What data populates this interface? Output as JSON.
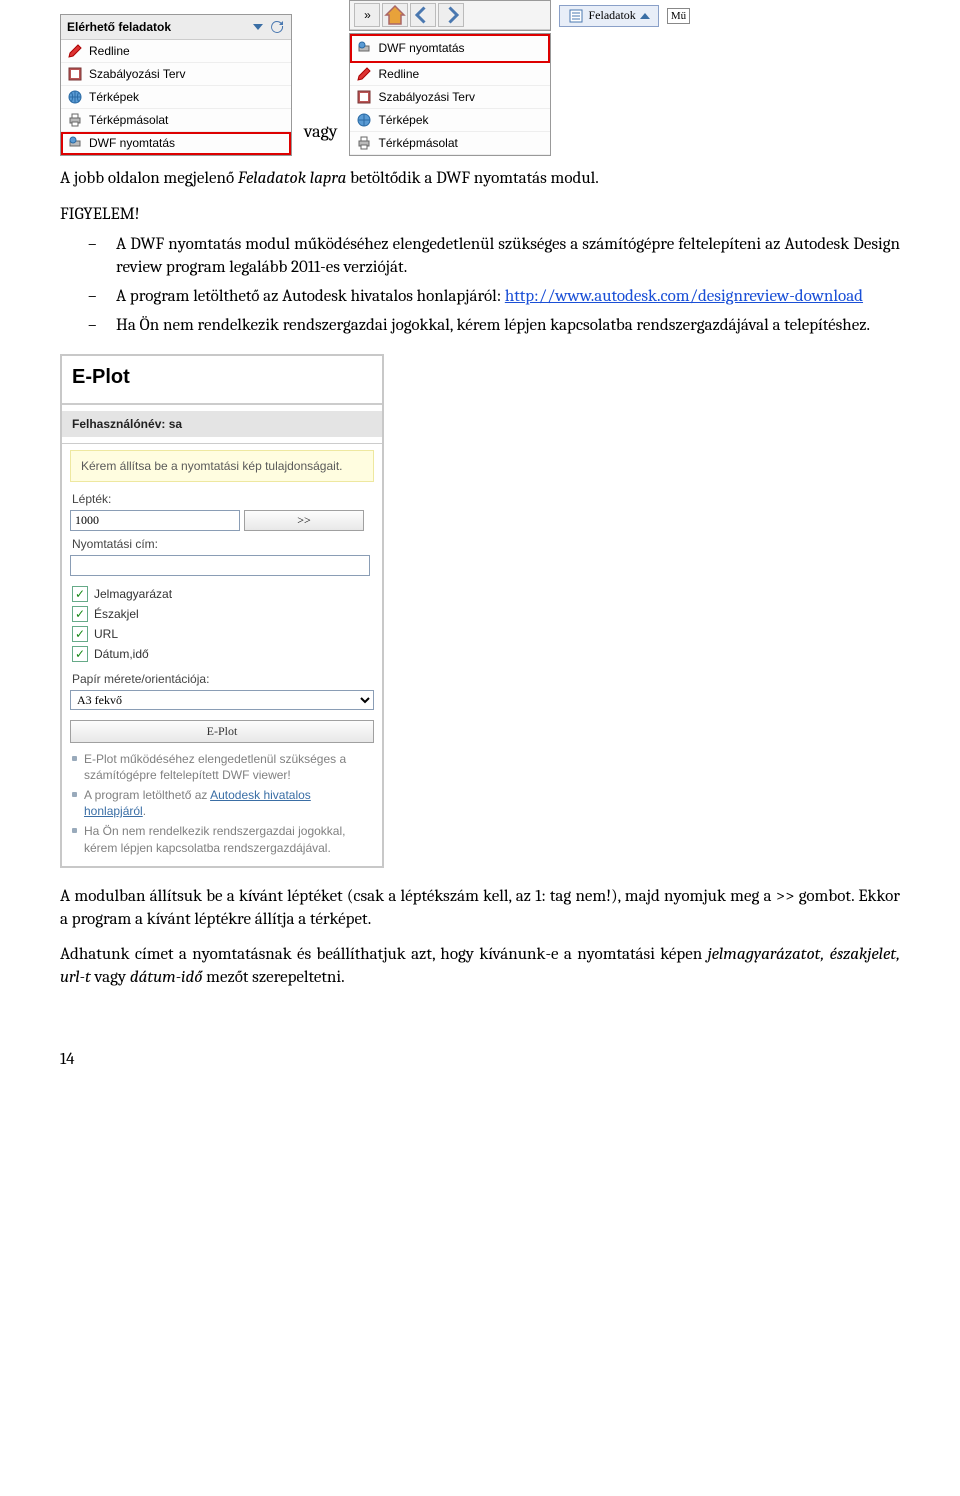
{
  "panels": {
    "left": {
      "title": "Elérhető feladatok",
      "items": [
        {
          "label": "Redline",
          "icon": "pencil-icon"
        },
        {
          "label": "Szabályozási Terv",
          "icon": "map-doc-icon"
        },
        {
          "label": "Térképek",
          "icon": "globe-icon"
        },
        {
          "label": "Térképmásolat",
          "icon": "printer-doc-icon"
        },
        {
          "label": "DWF nyomtatás",
          "icon": "dwf-print-icon",
          "highlight": true
        }
      ]
    },
    "right": {
      "tab_label": "Feladatok",
      "mu_chip": "Mű",
      "items": [
        {
          "label": "DWF nyomtatás",
          "icon": "dwf-print-icon",
          "highlight": true
        },
        {
          "label": "Redline",
          "icon": "pencil-icon"
        },
        {
          "label": "Szabályozási Terv",
          "icon": "map-doc-icon"
        },
        {
          "label": "Térképek",
          "icon": "globe-icon"
        },
        {
          "label": "Térképmásolat",
          "icon": "printer-doc-icon"
        }
      ]
    },
    "vagy": "vagy"
  },
  "body": {
    "p1_a": "A jobb oldalon megjelenő ",
    "p1_i": "Feladatok lapra",
    "p1_b": " betöltődik a DWF nyomtatás modul.",
    "figyelem": "FIGYELEM!",
    "b1": "A DWF nyomtatás modul működéséhez elengedetlenül szükséges a számítógépre feltelepíteni az  Autodesk Design review program legalább 2011-es verzióját.",
    "b2_a": "A program letölthető az Autodesk hivatalos honlapjáról: ",
    "b2_link": "http://www.autodesk.com/designreview-download",
    "b3": "Ha Ön nem rendelkezik rendszergazdai jogokkal, kérem lépjen kapcsolatba rendszergazdájával a telepítéshez.",
    "p2": "A modulban állítsuk be a kívánt léptéket (csak a léptékszám kell, az 1: tag nem!), majd nyomjuk meg a >> gombot. Ekkor a program a kívánt léptékre állítja a térképet.",
    "p3_a": "Adhatunk címet a nyomtatásnak és beállíthatjuk azt, hogy kívánunk-e a nyomtatási képen ",
    "p3_i": "jelmagyarázatot, északjelet, url-t",
    "p3_b": " vagy ",
    "p3_i2": "dátum-idő",
    "p3_c": " mezőt szerepeltetni.",
    "page_no": "14"
  },
  "eplot": {
    "title": "E-Plot",
    "user": "Felhasználónév: sa",
    "hint": "Kérem állítsa be a nyomtatási kép tulajdonságait.",
    "scale_label": "Lépték:",
    "scale_value": "1000",
    "go": ">>",
    "print_title_label": "Nyomtatási cím:",
    "checks": [
      "Jelmagyarázat",
      "Északjel",
      "URL",
      "Dátum,idő"
    ],
    "paper_label": "Papír mérete/orientációja:",
    "paper_value": "A3 fekvő",
    "big_button": "E-Plot",
    "notes": {
      "n1": "E-Plot működéséhez elengedetlenül szükséges a számítógépre feltelepített DWF viewer!",
      "n2a": "A program letölthető az ",
      "n2link": "Autodesk hivatalos honlapjáról",
      "n2b": ".",
      "n3": "Ha Ön nem rendelkezik rendszergazdai jogokkal, kérem lépjen kapcsolatba rendszergazdájával."
    }
  }
}
